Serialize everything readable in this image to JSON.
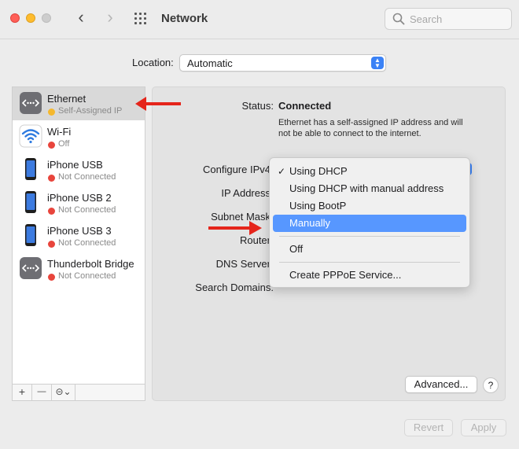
{
  "window": {
    "title": "Network",
    "search_placeholder": "Search"
  },
  "location": {
    "label": "Location:",
    "value": "Automatic"
  },
  "services": [
    {
      "name": "Ethernet",
      "status": "Self-Assigned IP",
      "status_color": "#f5b82e",
      "icon": "ethernet-icon",
      "selected": true
    },
    {
      "name": "Wi-Fi",
      "status": "Off",
      "status_color": "#e8453c",
      "icon": "wifi-icon",
      "selected": false
    },
    {
      "name": "iPhone USB",
      "status": "Not Connected",
      "status_color": "#e8453c",
      "icon": "iphone-icon",
      "selected": false
    },
    {
      "name": "iPhone USB 2",
      "status": "Not Connected",
      "status_color": "#e8453c",
      "icon": "iphone-icon",
      "selected": false
    },
    {
      "name": "iPhone USB 3",
      "status": "Not Connected",
      "status_color": "#e8453c",
      "icon": "iphone-icon",
      "selected": false
    },
    {
      "name": "Thunderbolt Bridge",
      "status": "Not Connected",
      "status_color": "#e8453c",
      "icon": "thunderbolt-icon",
      "selected": false
    }
  ],
  "sidebar_toolbar": {
    "add": "+",
    "remove": "—",
    "action": "⊝⌄"
  },
  "detail": {
    "status_label": "Status:",
    "status_value": "Connected",
    "status_description": "Ethernet has a self-assigned IP address and will not be able to connect to the internet.",
    "configure_label": "Configure IPv4",
    "ip_label": "IP Address",
    "subnet_label": "Subnet Mask",
    "router_label": "Router",
    "dns_label": "DNS Server",
    "search_domains_label": "Search Domains:"
  },
  "dropdown": {
    "items": [
      {
        "label": "Using DHCP",
        "checked": true
      },
      {
        "label": "Using DHCP with manual address"
      },
      {
        "label": "Using BootP"
      },
      {
        "label": "Manually",
        "highlighted": true
      },
      {
        "label": "Off"
      },
      {
        "label": "Create PPPoE Service..."
      }
    ]
  },
  "buttons": {
    "advanced": "Advanced...",
    "help": "?",
    "revert": "Revert",
    "apply": "Apply"
  },
  "colors": {
    "accent": "#3b82f6",
    "highlight": "#5797ff",
    "annotation_arrow": "#e5251b"
  }
}
